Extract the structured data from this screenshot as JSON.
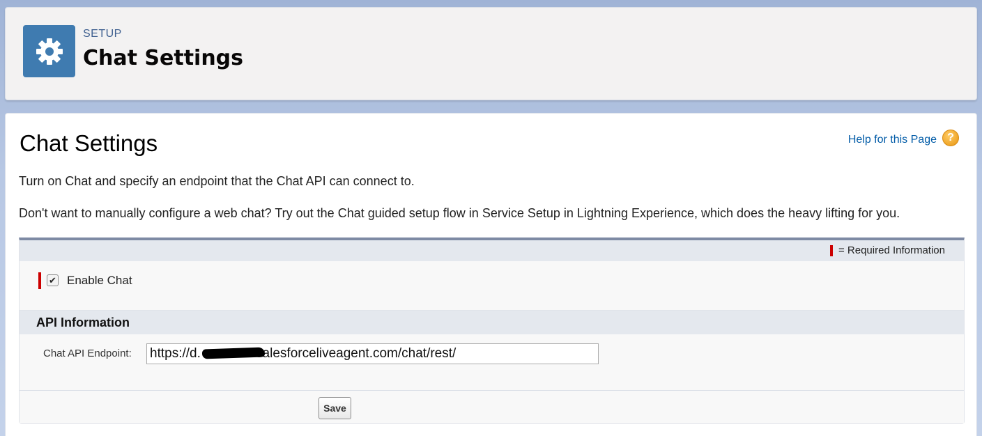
{
  "header": {
    "breadcrumb": "SETUP",
    "title": "Chat Settings",
    "icon": "gear-icon"
  },
  "page": {
    "title": "Chat Settings",
    "help_link": "Help for this Page",
    "help_icon": "?",
    "description_1": "Turn on Chat and specify an endpoint that the Chat API can connect to.",
    "description_2": "Don't want to manually configure a web chat? Try out the Chat guided setup flow in Service Setup in Lightning Experience, which does the heavy lifting for you."
  },
  "form": {
    "required_legend": "= Required Information",
    "enable_chat_label": "Enable Chat",
    "enable_chat_checked": true,
    "enable_chat_checkmark": "✔",
    "section_title": "API Information",
    "endpoint_label": "Chat API Endpoint:",
    "endpoint_value": "https://d.              .salesforceliveagent.com/chat/rest/",
    "save_label": "Save"
  },
  "colors": {
    "accent": "#3f7bb0",
    "required": "#cc0000",
    "link": "#015ba7"
  }
}
